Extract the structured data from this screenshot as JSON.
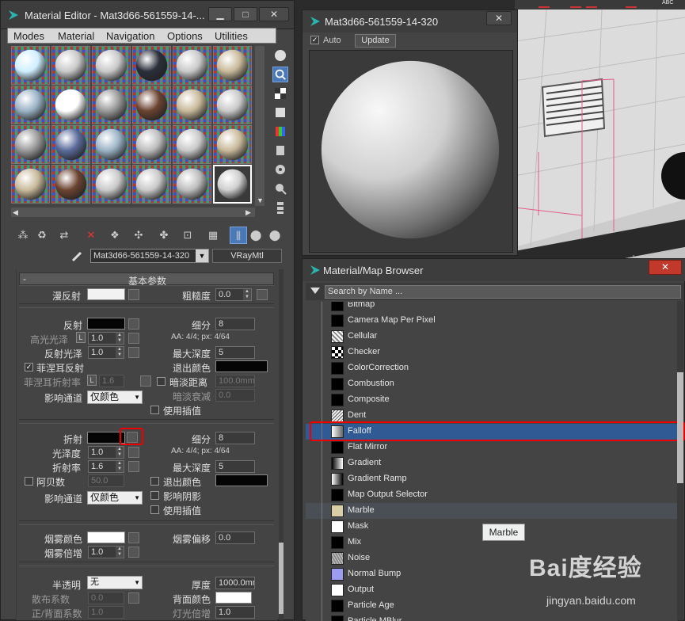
{
  "material_editor": {
    "title": "Material Editor - Mat3d66-561559-14-...",
    "menu": [
      "Modes",
      "Material",
      "Navigation",
      "Options",
      "Utilities"
    ],
    "material_name": "Mat3d66-561559-14-320",
    "material_type": "VRayMtl",
    "rollout_title": "基本参数",
    "diffuse": {
      "label": "漫反射",
      "roughness_label": "粗糙度",
      "roughness": "0.0",
      "color": "#f2f2f2"
    },
    "reflection": {
      "label": "反射",
      "color": "#050505",
      "glossiness_label": "高光光泽",
      "glossiness": "1.0",
      "lock": "L",
      "refl_gloss_label": "反射光泽",
      "refl_gloss": "1.0",
      "fresnel_label": "菲涅耳反射",
      "fresnel_checked": "✓",
      "fresnel_ior_label": "菲涅耳折射率",
      "fresnel_ior": "1.6",
      "subdivs_label": "细分",
      "subdivs": "8",
      "aa_info": "AA: 4/4; px: 4/64",
      "max_depth_label": "最大深度",
      "max_depth": "5",
      "exit_color_label": "退出颜色",
      "dim_distance_label": "暗淡距离",
      "dim_distance": "100.0mm",
      "dim_falloff_label": "暗淡衰减",
      "dim_falloff": "0.0",
      "affect_channels_label": "影响通道",
      "affect_channels": "仅颜色",
      "use_interp_label": "使用插值"
    },
    "refraction": {
      "label": "折射",
      "color": "#050505",
      "glossiness_label": "光泽度",
      "glossiness": "1.0",
      "ior_label": "折射率",
      "ior": "1.6",
      "abbe_label": "阿贝数",
      "abbe": "50.0",
      "subdivs_label": "细分",
      "subdivs": "8",
      "aa_info": "AA: 4/4; px: 4/64",
      "max_depth_label": "最大深度",
      "max_depth": "5",
      "exit_color_label": "退出颜色",
      "affect_shadows_label": "影响阴影",
      "affect_channels_label": "影响通道",
      "affect_channels": "仅颜色",
      "use_interp_label": "使用插值"
    },
    "fog": {
      "color_label": "烟雾颜色",
      "color": "#ffffff",
      "mult_label": "烟雾倍增",
      "mult": "1.0",
      "bias_label": "烟雾偏移",
      "bias": "0.0"
    },
    "translucency": {
      "label": "半透明",
      "value": "无",
      "scatter_label": "散布系数",
      "scatter": "0.0",
      "fb_label": "正/背面系数",
      "fb": "1.0",
      "thickness_label": "厚度",
      "thickness": "1000.0mm",
      "back_color_label": "背面颜色",
      "light_mult_label": "灯光倍增",
      "light_mult": "1.0"
    }
  },
  "preview": {
    "title": "Mat3d66-561559-14-320",
    "auto_label": "Auto",
    "update_label": "Update"
  },
  "browser": {
    "title": "Material/Map Browser",
    "search_placeholder": "Search by Name ...",
    "items": [
      {
        "name": "Bitmap",
        "icon": "bitmap-icon"
      },
      {
        "name": "Camera Map Per Pixel",
        "icon": "camera-map-icon"
      },
      {
        "name": "Cellular",
        "icon": "cellular-icon"
      },
      {
        "name": "Checker",
        "icon": "checker-icon"
      },
      {
        "name": "ColorCorrection",
        "icon": "color-correction-icon"
      },
      {
        "name": "Combustion",
        "icon": "combustion-icon"
      },
      {
        "name": "Composite",
        "icon": "composite-icon"
      },
      {
        "name": "Dent",
        "icon": "dent-icon"
      },
      {
        "name": "Falloff",
        "icon": "falloff-icon"
      },
      {
        "name": "Flat Mirror",
        "icon": "flat-mirror-icon"
      },
      {
        "name": "Gradient",
        "icon": "gradient-icon"
      },
      {
        "name": "Gradient Ramp",
        "icon": "gradient-ramp-icon"
      },
      {
        "name": "Map Output Selector",
        "icon": "map-output-icon"
      },
      {
        "name": "Marble",
        "icon": "marble-icon"
      },
      {
        "name": "Mask",
        "icon": "mask-icon"
      },
      {
        "name": "Mix",
        "icon": "mix-icon"
      },
      {
        "name": "Noise",
        "icon": "noise-icon"
      },
      {
        "name": "Normal Bump",
        "icon": "normal-bump-icon"
      },
      {
        "name": "Output",
        "icon": "output-icon"
      },
      {
        "name": "Particle Age",
        "icon": "particle-age-icon"
      },
      {
        "name": "Particle MBlur",
        "icon": "particle-mblur-icon"
      }
    ],
    "selected": "Falloff",
    "tooltip": "Marble"
  },
  "watermark": {
    "text": "Bai度经验",
    "url": "jingyan.baidu.com"
  },
  "topbar_text": "ABC"
}
